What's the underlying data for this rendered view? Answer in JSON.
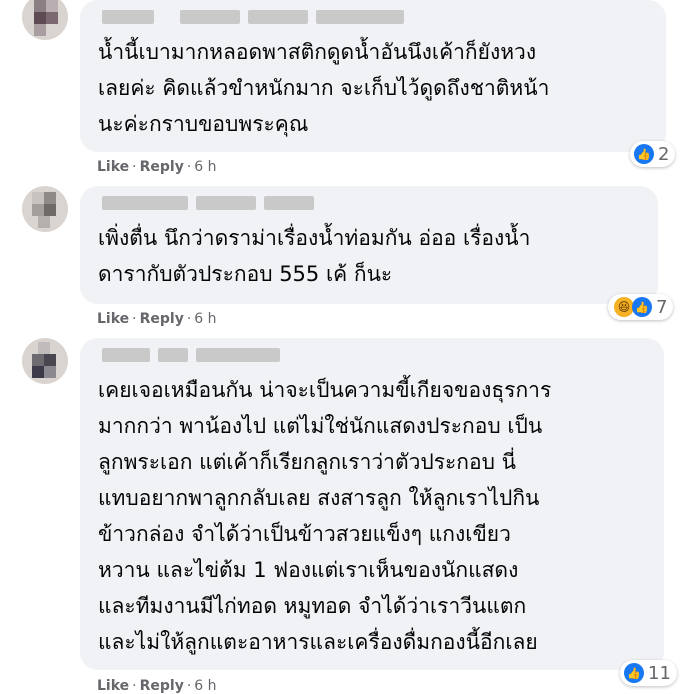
{
  "comments": [
    {
      "lines": [
        "น้ำนี้เบามากหลอดพาสติกดูดน้ำอันนึงเค้าก็ยังหวง",
        "เลยค่ะ คิดแล้วขำหนักมาก จะเก็บไว้ดูดถึงชาติหน้า",
        "นะค่ะกราบขอบพระคุณ"
      ],
      "actions": {
        "like": "Like",
        "dot": "·",
        "reply": "Reply",
        "time": "6 h"
      },
      "reaction_count": "2",
      "reaction_icons": [
        "like-icon"
      ]
    },
    {
      "lines": [
        "เพิ่งตื่น นึกว่าดราม่าเรื่องน้ำท่อมกัน อ่ออ เรื่องน้ำ",
        "ดารากับตัวประกอบ 555 เค้ ก็นะ"
      ],
      "actions": {
        "like": "Like",
        "dot": "·",
        "reply": "Reply",
        "time": "6 h"
      },
      "reaction_count": "7",
      "reaction_icons": [
        "haha-icon",
        "like-icon"
      ]
    },
    {
      "lines": [
        "เคยเจอเหมือนกัน น่าจะเป็นความขี้เกียจของธุรการ",
        "มากกว่า พาน้องไป แต่ไม่ใช่นักแสดงประกอบ เป็น",
        "ลูกพระเอก แต่เค้าก็เรียกลูกเราว่าตัวประกอบ นี่",
        "แทบอยากพาลูกกลับเลย สงสารลูก ให้ลูกเราไปกิน",
        "ข้าวกล่อง จำได้ว่าเป็นข้าวสวยแข็งๆ แกงเขียว",
        "หวาน และไข่ต้ม 1 ฟองแต่เราเห็นของนักแสดง",
        "และทีมงานมีไก่ทอด หมูทอด จำได้ว่าเราวีนแตก",
        "และไม่ให้ลูกแตะอาหารและเครื่องดื่มกองนี้อีกเลย"
      ],
      "actions": {
        "like": "Like",
        "dot": "·",
        "reply": "Reply",
        "time": "6 h"
      },
      "reaction_count": "11",
      "reaction_icons": [
        "like-icon"
      ]
    }
  ],
  "colors": {
    "bubble": "#f0f2f5",
    "meta": "#65676b",
    "like_blue": "#1877f2",
    "haha_yellow": "#f7b125"
  }
}
